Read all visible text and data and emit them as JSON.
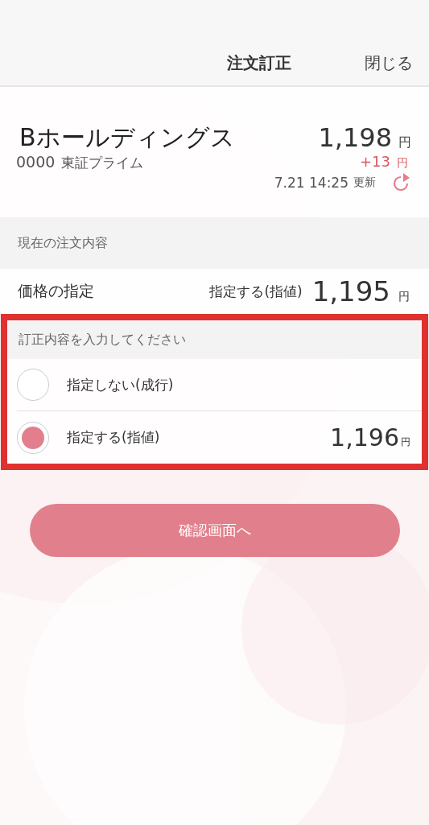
{
  "header": {
    "title": "注文訂正",
    "close": "閉じる"
  },
  "stock": {
    "name": "Bホールディングス",
    "code": "0000",
    "market": "東証プライム",
    "price": "1,198",
    "price_unit": "円",
    "change": "+13",
    "change_unit": "円",
    "updated": "7.21 14:25",
    "updated_label": "更新"
  },
  "current": {
    "heading": "現在の注文内容",
    "label": "価格の指定",
    "type": "指定する(指値)",
    "price": "1,195",
    "unit": "円"
  },
  "correction": {
    "heading": "訂正内容を入力してください",
    "options": [
      {
        "label": "指定しない(成行)",
        "selected": false
      },
      {
        "label": "指定する(指値)",
        "selected": true,
        "price": "1,196",
        "unit": "円"
      }
    ]
  },
  "confirm_button": "確認画面へ"
}
